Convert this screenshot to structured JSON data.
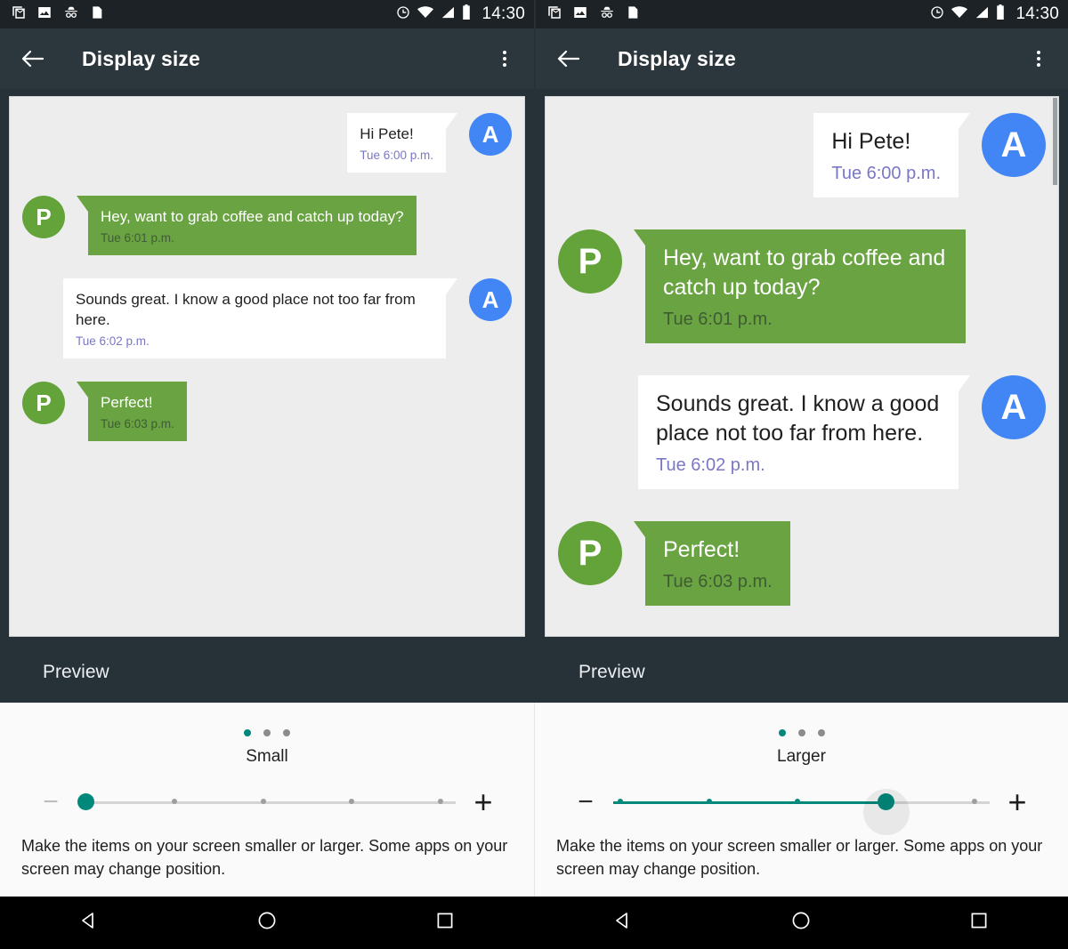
{
  "statusbar": {
    "icons": [
      "gmail-icon",
      "photos-icon",
      "incognito-icon",
      "docs-icon"
    ],
    "right_icons": [
      "alarm-icon",
      "wifi-icon",
      "signal-icon",
      "battery-icon"
    ],
    "time": "14:30"
  },
  "appbar": {
    "back_icon": "back-arrow-icon",
    "title": "Display size",
    "overflow_icon": "overflow-menu-icon"
  },
  "preview": {
    "label": "Preview"
  },
  "conversation": {
    "messages": [
      {
        "sender": "A",
        "side": "out",
        "style": "white",
        "text": "Hi Pete!",
        "time": "Tue 6:00 p.m."
      },
      {
        "sender": "P",
        "side": "in",
        "style": "green",
        "text": "Hey, want to grab coffee and catch up today?",
        "time": "Tue 6:01 p.m."
      },
      {
        "sender": "A",
        "side": "out",
        "style": "white",
        "text": "Sounds great. I know a good place not too far from here.",
        "time": "Tue 6:02 p.m."
      },
      {
        "sender": "P",
        "side": "in",
        "style": "green",
        "text": "Perfect!",
        "time": "Tue 6:03 p.m."
      }
    ]
  },
  "left_panel": {
    "size_label": "Small",
    "active_dot": 0,
    "slider": {
      "value": 0,
      "steps": 5,
      "minus_enabled": false,
      "plus_enabled": true
    },
    "minus_label": "−",
    "plus_label": "+",
    "helper_text": "Make the items on your screen smaller or larger. Some apps on your screen may change position."
  },
  "right_panel": {
    "size_label": "Larger",
    "active_dot": 0,
    "slider": {
      "value": 3,
      "steps": 5,
      "minus_enabled": true,
      "plus_enabled": true
    },
    "minus_label": "−",
    "plus_label": "+",
    "helper_text": "Make the items on your screen smaller or larger. Some apps on your screen may change position."
  },
  "navbar": {
    "back": "back-triangle-icon",
    "home": "home-circle-icon",
    "recents": "recents-square-icon"
  },
  "colors": {
    "appbar": "#2b373d",
    "statusbar": "#1c2226",
    "accent_teal": "#00897b",
    "bubble_green": "#6aa342",
    "avatar_blue": "#4285f4",
    "avatar_green": "#63a33a",
    "timestamp_purple": "#7a77c4"
  }
}
